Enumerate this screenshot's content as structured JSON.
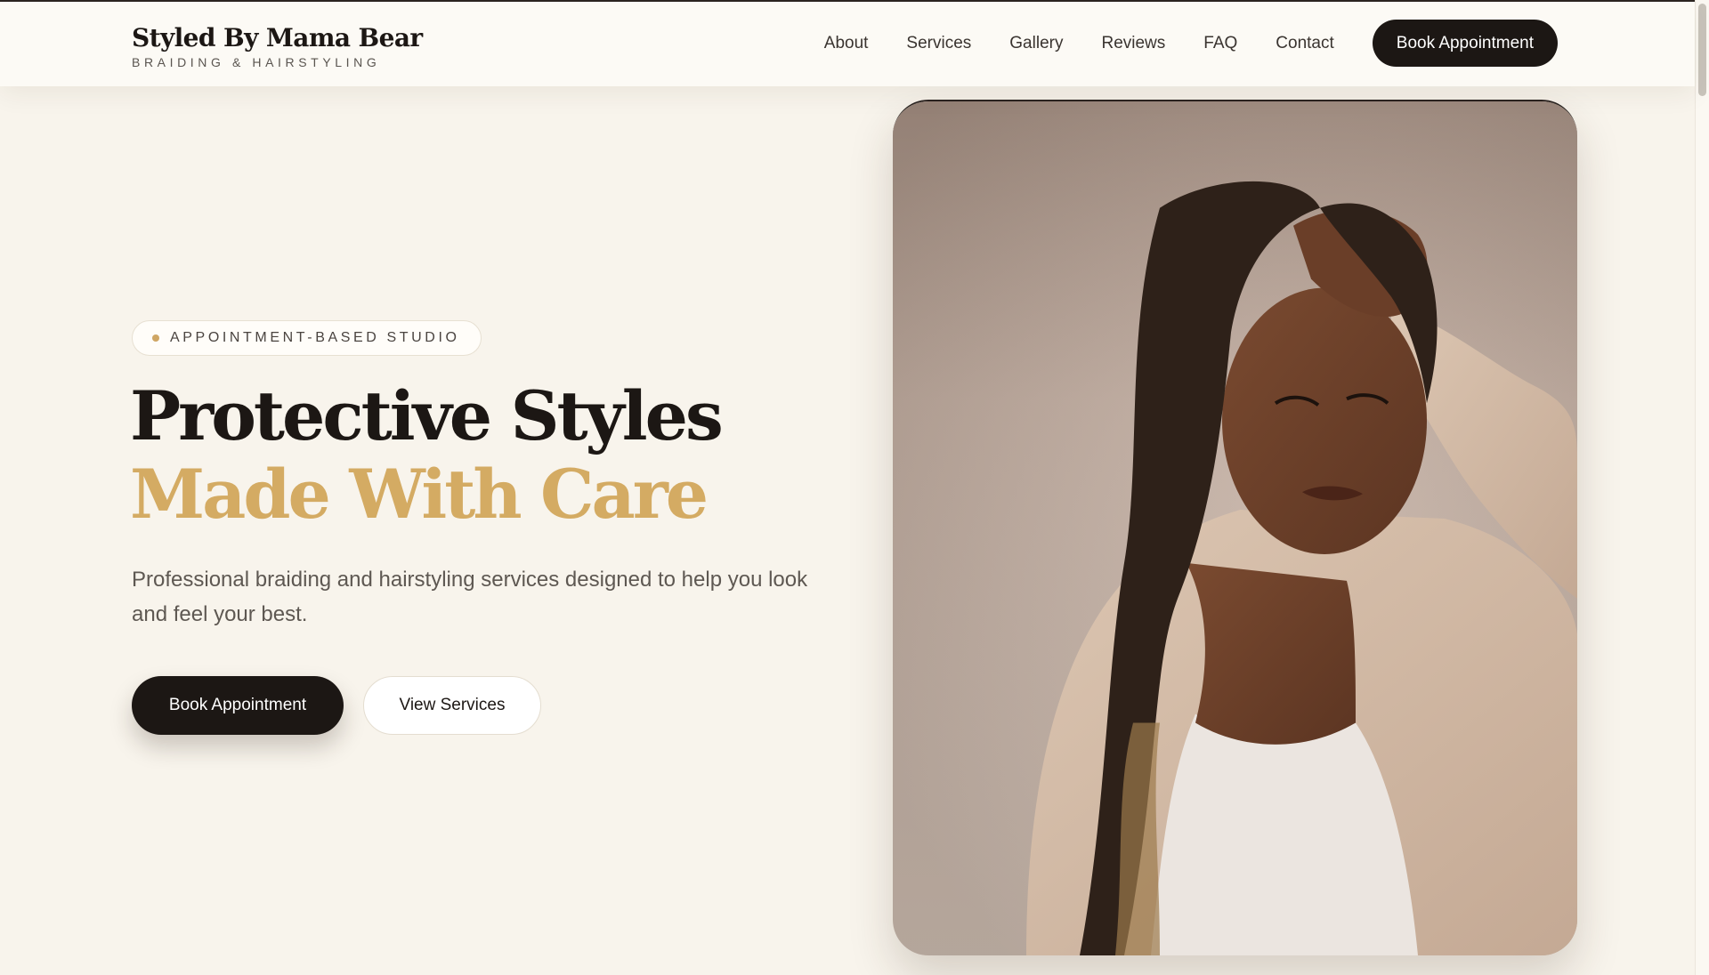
{
  "header": {
    "brand_name": "Styled By Mama Bear",
    "brand_tagline": "BRAIDING & HAIRSTYLING",
    "nav": [
      {
        "label": "About"
      },
      {
        "label": "Services"
      },
      {
        "label": "Gallery"
      },
      {
        "label": "Reviews"
      },
      {
        "label": "FAQ"
      },
      {
        "label": "Contact"
      }
    ],
    "cta_label": "Book Appointment"
  },
  "hero": {
    "eyebrow": "APPOINTMENT-BASED STUDIO",
    "headline_line1": "Protective Styles",
    "headline_line2": "Made With Care",
    "subtext": "Professional braiding and hairstyling services designed to help you look and feel your best.",
    "primary_button": "Book Appointment",
    "secondary_button": "View Services",
    "image_icon": "portrait-photo"
  },
  "colors": {
    "background": "#f8f4ec",
    "header_background": "#fcfaf5",
    "dark": "#1c1714",
    "accent_gold": "#d4ab63",
    "muted_text": "#5e5852"
  }
}
